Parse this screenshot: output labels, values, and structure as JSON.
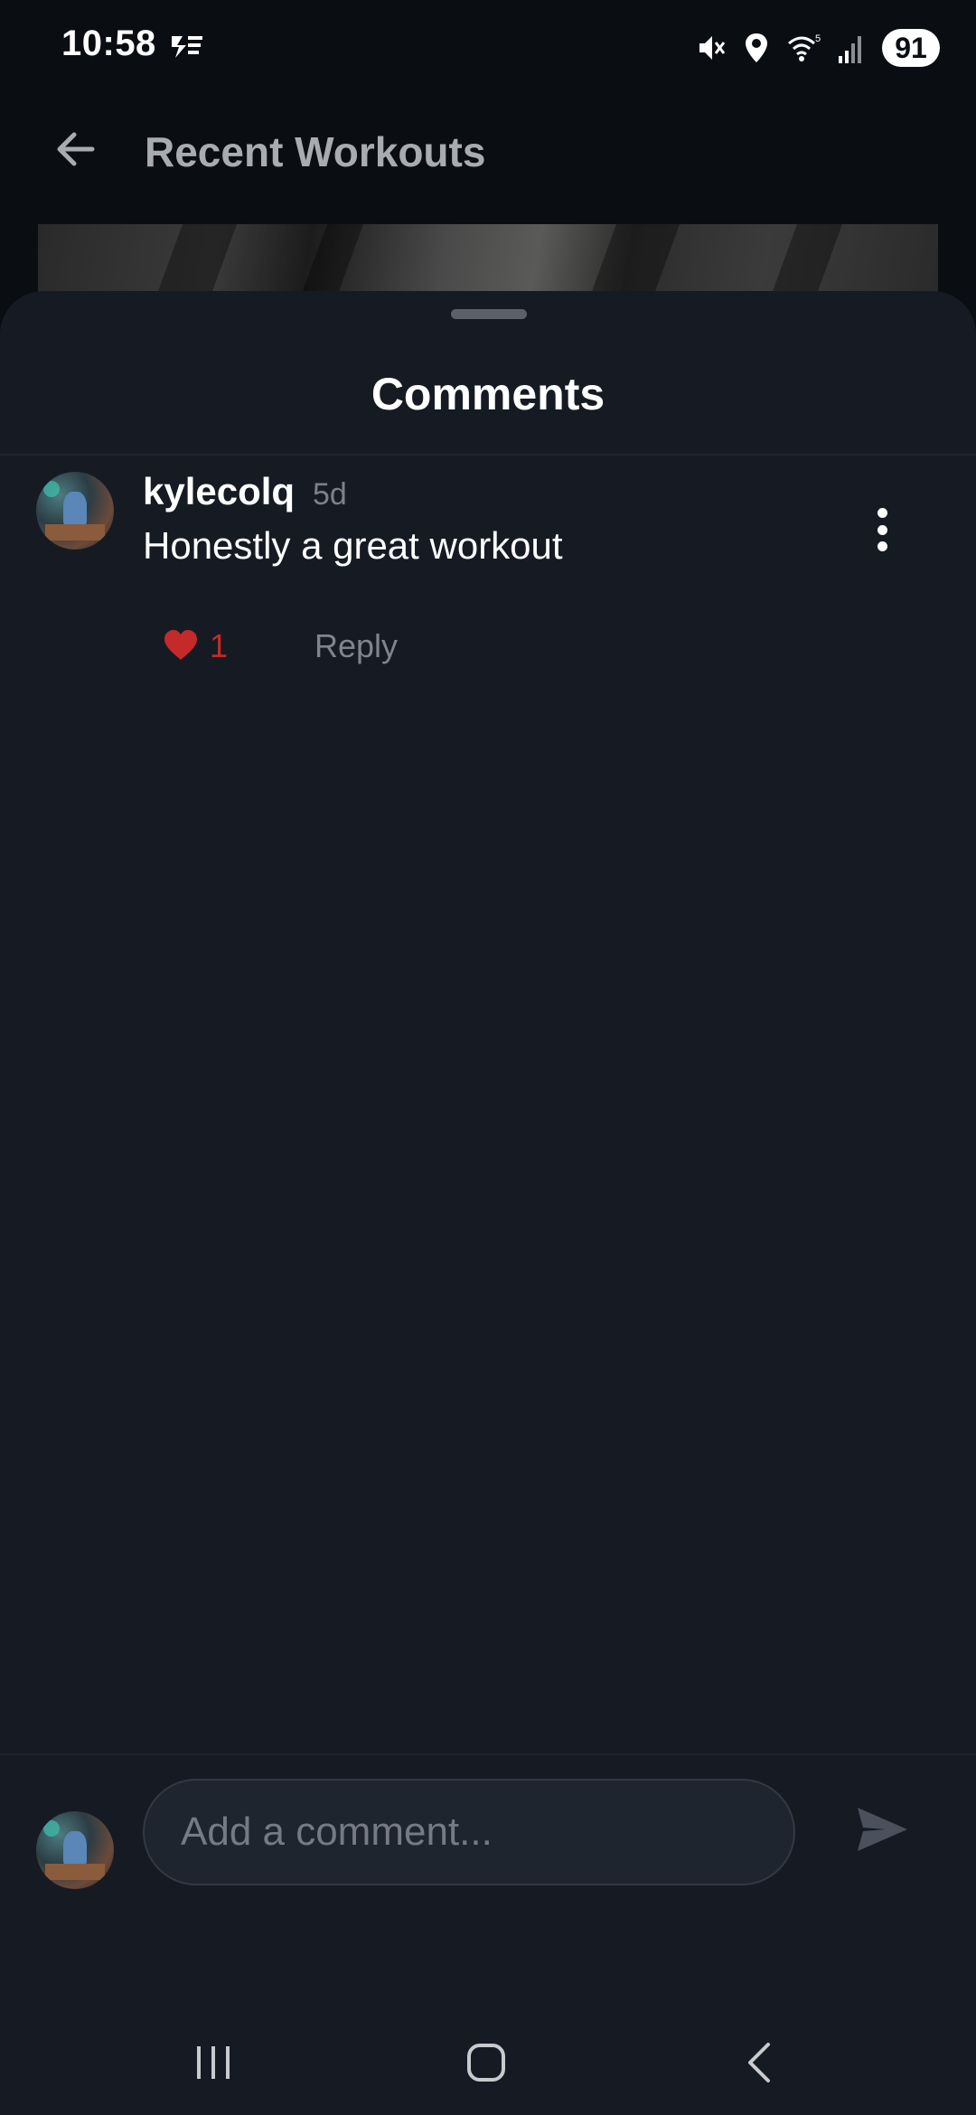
{
  "status_bar": {
    "time": "10:58",
    "battery": "91",
    "icons": [
      "app-notification-icon",
      "mute-icon",
      "location-icon",
      "wifi-icon",
      "signal-icon"
    ]
  },
  "header": {
    "title": "Recent Workouts",
    "back_icon": "arrow-left-icon"
  },
  "sheet": {
    "title": "Comments",
    "comments": [
      {
        "username": "kylecolq",
        "time": "5d",
        "text": "Honestly a great workout",
        "likes": "1",
        "reply_label": "Reply"
      }
    ]
  },
  "composer": {
    "placeholder": "Add a comment...",
    "value": "",
    "send_icon": "send-icon"
  },
  "nav_bar": {
    "icons": [
      "recents-icon",
      "home-icon",
      "back-icon"
    ]
  },
  "colors": {
    "sheet_bg": "#161b23",
    "page_bg": "#0a0d12",
    "like": "#c42a2a",
    "muted_text": "#7b818b"
  }
}
